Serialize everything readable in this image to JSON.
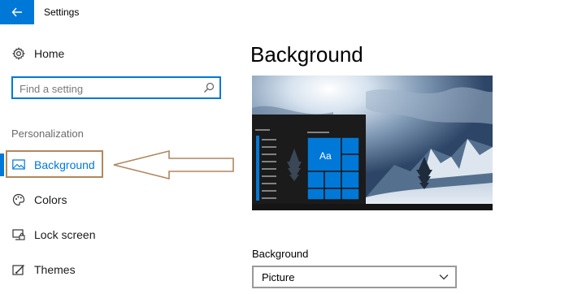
{
  "window": {
    "title": "Settings"
  },
  "nav": {
    "home_label": "Home",
    "search_placeholder": "Find a setting",
    "section_label": "Personalization",
    "items": [
      {
        "label": "Background",
        "icon": "picture-icon",
        "active": true
      },
      {
        "label": "Colors",
        "icon": "palette-icon",
        "active": false
      },
      {
        "label": "Lock screen",
        "icon": "lock-screen-icon",
        "active": false
      },
      {
        "label": "Themes",
        "icon": "themes-icon",
        "active": false
      }
    ]
  },
  "main": {
    "title": "Background",
    "preview": {
      "tile_text": "Aa"
    },
    "background_field": {
      "label": "Background",
      "value": "Picture"
    }
  },
  "colors": {
    "accent": "#0078d7",
    "annotation": "#b0875f"
  }
}
